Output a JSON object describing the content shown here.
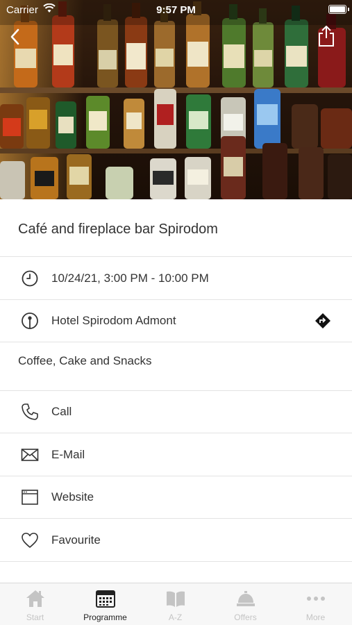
{
  "status_bar": {
    "carrier": "Carrier",
    "time": "9:57 PM"
  },
  "hero": {
    "icons": {
      "back": "chevron-left-icon",
      "share": "share-icon"
    }
  },
  "event": {
    "title": "Café and fireplace bar Spirodom",
    "datetime": "10/24/21, 3:00 PM - 10:00 PM",
    "location": "Hotel Spirodom Admont",
    "description": "Coffee, Cake and Snacks"
  },
  "actions": {
    "call": "Call",
    "email": "E-Mail",
    "website": "Website",
    "favourite": "Favourite"
  },
  "tabbar": {
    "active_index": 1,
    "items": [
      {
        "label": "Start",
        "icon": "home-icon"
      },
      {
        "label": "Programme",
        "icon": "calendar-icon"
      },
      {
        "label": "A-Z",
        "icon": "book-icon"
      },
      {
        "label": "Offers",
        "icon": "service-bell-icon"
      },
      {
        "label": "More",
        "icon": "more-dots-icon"
      }
    ]
  },
  "colors": {
    "active_tab": "#222222",
    "inactive_tab": "#c4c4c4",
    "divider": "#e3e3e3"
  }
}
